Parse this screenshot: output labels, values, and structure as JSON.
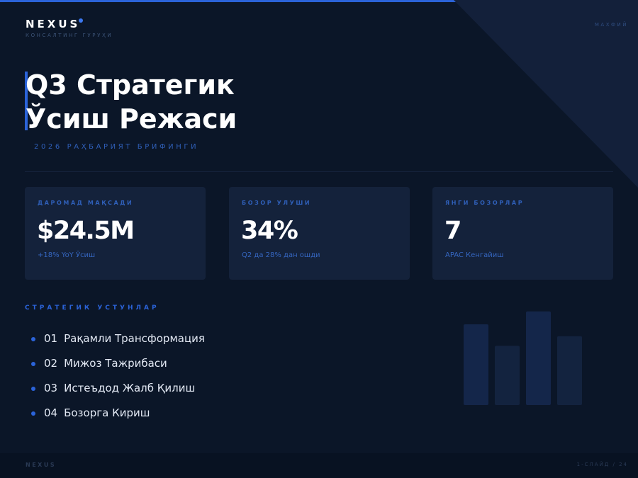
{
  "brand": {
    "name": "NEXUS",
    "tagline": "КОНСАЛТИНГ ГУРУҲИ",
    "accent_color": "#2b63d9"
  },
  "classification": "МАХФИЙ",
  "title": {
    "line1": "Q3 Стратегик",
    "line2": "Ўсиш Режаси"
  },
  "subtitle": "2026 РАҲБАРИЯТ БРИФИНГИ",
  "kpis": [
    {
      "label": "ДАРОМАД МАҚСАДИ",
      "value": "$24.5M",
      "note": "+18% YoY Ўсиш"
    },
    {
      "label": "БОЗОР УЛУШИ",
      "value": "34%",
      "note": "Q2 да 28% дан ошди"
    },
    {
      "label": "ЯНГИ БОЗОРЛАР",
      "value": "7",
      "note": "APAC Кенгайиш"
    }
  ],
  "pillars": {
    "heading": "СТРАТЕГИК УСТУНЛАР",
    "items": [
      {
        "num": "01",
        "label": "Рақамли Трансформация"
      },
      {
        "num": "02",
        "label": "Мижоз Тажрибаси"
      },
      {
        "num": "03",
        "label": "Истеъдод Жалб Қилиш"
      },
      {
        "num": "04",
        "label": "Бозорга Кириш"
      }
    ]
  },
  "decor_bars": {
    "levels": [
      0.75,
      0.55,
      0.87,
      0.64
    ],
    "colors": [
      "#14264a",
      "#13233f",
      "#14264a",
      "#13233f"
    ]
  },
  "footer": {
    "brand": "NEXUS",
    "page": "1-СЛАЙД / 24"
  }
}
